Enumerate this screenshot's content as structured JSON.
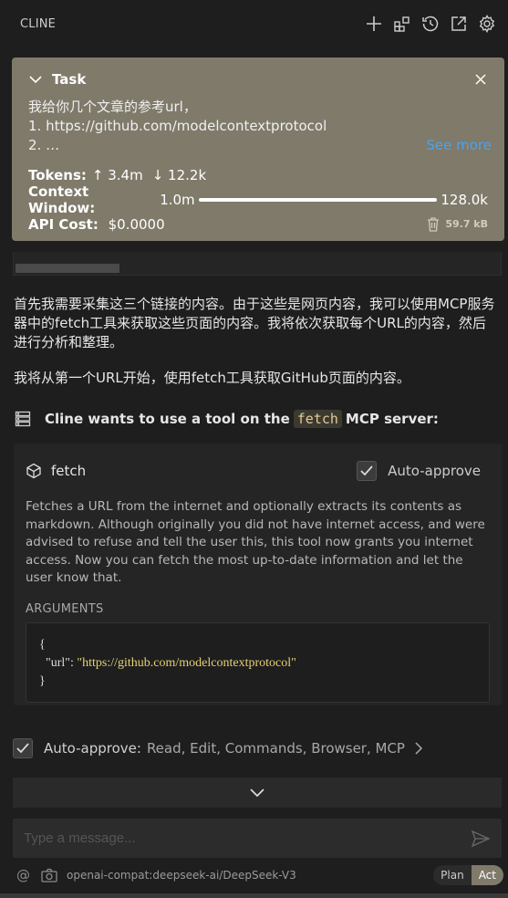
{
  "app": {
    "title": "CLINE"
  },
  "top_icons": [
    "plus-icon",
    "mcp-servers-icon",
    "history-icon",
    "popout-icon",
    "settings-icon"
  ],
  "task": {
    "header": "Task",
    "text_line1": "我给你几个文章的参考url，",
    "text_line2": "1. https://github.com/modelcontextprotocol",
    "text_line3": "2. …",
    "see_more": "See more",
    "tokens_label": "Tokens:",
    "tokens_up": "↑ 3.4m",
    "tokens_down": "↓ 12.2k",
    "context_label": "Context Window:",
    "context_used": "1.0m",
    "context_max": "128.0k",
    "api_cost_label": "API Cost:",
    "api_cost_value": "$0.0000",
    "size": "59.7 kB"
  },
  "messages": {
    "m1": "首先我需要采集这三个链接的内容。由于这些是网页内容，我可以使用MCP服务器中的fetch工具来获取这些页面的内容。我将依次获取每个URL的内容，然后进行分析和整理。",
    "m2": "我将从第一个URL开始，使用fetch工具获取GitHub页面的内容。"
  },
  "tool_request": {
    "prefix": "Cline wants to use a tool on the",
    "server": "fetch",
    "suffix": "MCP server:",
    "tool_name": "fetch",
    "auto_approve_label": "Auto-approve",
    "description": "Fetches a URL from the internet and optionally extracts its contents as markdown. Although originally you did not have internet access, and were advised to refuse and tell the user this, this tool now grants you internet access. Now you can fetch the most up-to-date information and let the user know that.",
    "arguments_label": "ARGUMENTS",
    "args_open": "{",
    "args_key": "\"url\": ",
    "args_value": "\"https://github.com/modelcontextprotocol\"",
    "args_close": "}"
  },
  "auto_approve_bar": {
    "label": "Auto-approve:",
    "items": "Read, Edit, Commands, Browser, MCP"
  },
  "input": {
    "placeholder": "Type a message..."
  },
  "footer": {
    "at": "@",
    "model": "openai-compat:deepseek-ai/DeepSeek-V3",
    "mode_plan": "Plan",
    "mode_act": "Act"
  },
  "colors": {
    "task_bg": "#7f7a6a",
    "link": "#4aa3f0",
    "code_tag": "#e7c896"
  }
}
